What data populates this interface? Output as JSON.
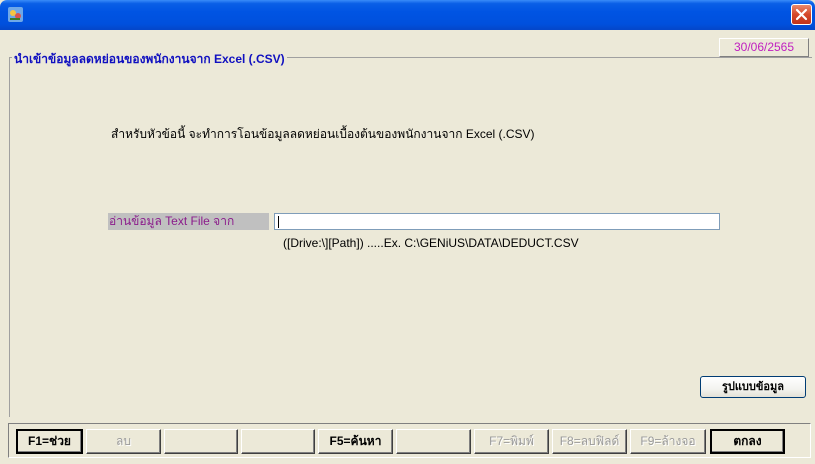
{
  "window": {
    "close_glyph": "✕"
  },
  "header": {
    "date": "30/06/2565"
  },
  "group": {
    "title": "นำเข้าข้อมูลลดหย่อนของพนักงานจาก Excel (.CSV)"
  },
  "main": {
    "description": "สำหรับหัวข้อนี้ จะทำการโอนข้อมูลลดหย่อนเบื้องต้นของพนักงานจาก Excel (.CSV)",
    "path_label": "อ่านข้อมูล Text File จาก",
    "path_value": "",
    "path_hint": "([Drive:\\][Path]) .....Ex. C:\\GENiUS\\DATA\\DEDUCT.CSV",
    "format_button": "รูปแบบข้อมูล"
  },
  "function_keys": [
    {
      "label": "F1=ช่วย",
      "enabled": true
    },
    {
      "label": "ลบ",
      "enabled": false
    },
    {
      "label": "",
      "enabled": true
    },
    {
      "label": "",
      "enabled": true
    },
    {
      "label": "F5=ค้นหา",
      "enabled": true
    },
    {
      "label": "",
      "enabled": true
    },
    {
      "label": "F7=พิมพ์",
      "enabled": false
    },
    {
      "label": "F8=ลบฟิลด์",
      "enabled": false
    },
    {
      "label": "F9=ล้างจอ",
      "enabled": false
    },
    {
      "label": "ตกลง",
      "enabled": true
    }
  ],
  "colors": {
    "title_bar": "#0054E3",
    "group_title": "#1010C0",
    "date_text": "#C020C0",
    "path_label_text": "#8B1C8B"
  }
}
